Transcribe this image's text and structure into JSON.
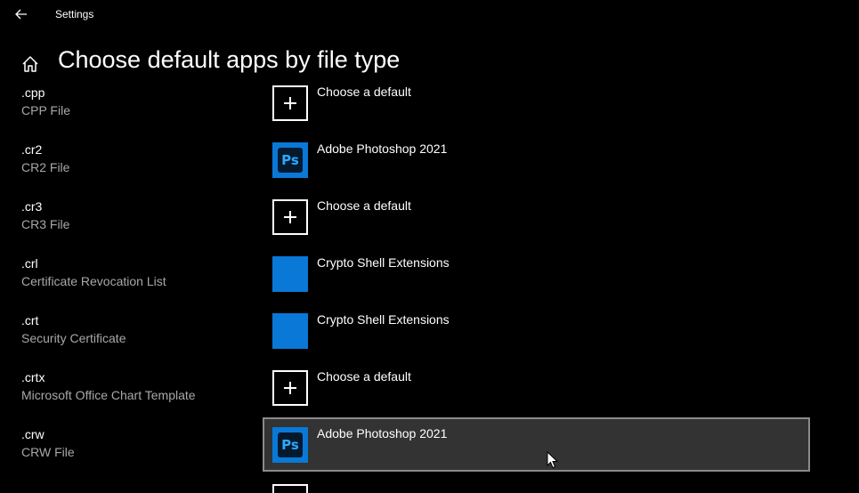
{
  "window": {
    "title": "Settings"
  },
  "page": {
    "title": "Choose default apps by file type"
  },
  "icons": {
    "back": "back-arrow-icon",
    "home": "home-icon",
    "add": "plus-icon",
    "photoshop": "photoshop-icon",
    "crypto": "crypto-shell-icon"
  },
  "colors": {
    "background": "#000000",
    "accent": "#0a78d7",
    "hover_background": "#333333",
    "secondary_text": "#a8a8a8"
  },
  "file_types": [
    {
      "ext": ".cpp",
      "desc": "CPP File",
      "app": "Choose a default",
      "icon": "plus"
    },
    {
      "ext": ".cr2",
      "desc": "CR2 File",
      "app": "Adobe Photoshop 2021",
      "icon": "ps"
    },
    {
      "ext": ".cr3",
      "desc": "CR3 File",
      "app": "Choose a default",
      "icon": "plus"
    },
    {
      "ext": ".crl",
      "desc": "Certificate Revocation List",
      "app": "Crypto Shell Extensions",
      "icon": "solid"
    },
    {
      "ext": ".crt",
      "desc": "Security Certificate",
      "app": "Crypto Shell Extensions",
      "icon": "solid"
    },
    {
      "ext": ".crtx",
      "desc": "Microsoft Office Chart Template",
      "app": "Choose a default",
      "icon": "plus"
    },
    {
      "ext": ".crw",
      "desc": "CRW File",
      "app": "Adobe Photoshop 2021",
      "icon": "ps",
      "hovered": true
    }
  ]
}
